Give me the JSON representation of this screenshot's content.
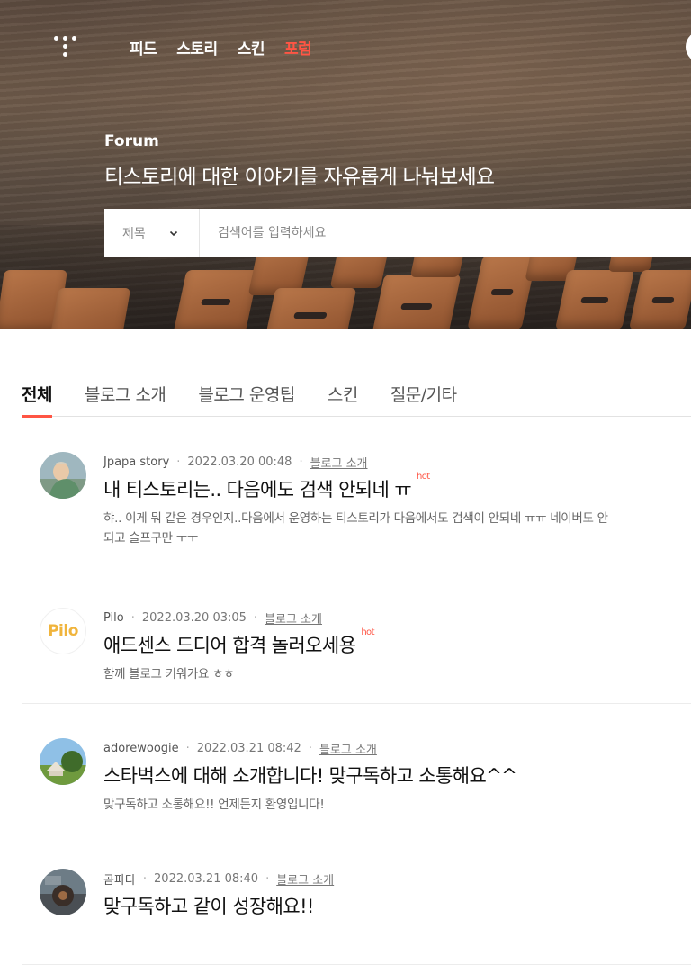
{
  "nav": {
    "items": [
      {
        "label": "피드",
        "active": false
      },
      {
        "label": "스토리",
        "active": false
      },
      {
        "label": "스킨",
        "active": false
      },
      {
        "label": "포럼",
        "active": true
      }
    ]
  },
  "hero": {
    "title": "Forum",
    "subtitle": "티스토리에 대한 이야기를 자유롭게 나눠보세요"
  },
  "search": {
    "scope": "제목",
    "placeholder": "검색어를 입력하세요"
  },
  "tabs": [
    {
      "label": "전체",
      "active": true
    },
    {
      "label": "블로그 소개",
      "active": false
    },
    {
      "label": "블로그 운영팁",
      "active": false
    },
    {
      "label": "스킨",
      "active": false
    },
    {
      "label": "질문/기타",
      "active": false
    }
  ],
  "posts": [
    {
      "author": "Jpapa story",
      "date": "2022.03.20 00:48",
      "category": "블로그 소개",
      "title": "내 티스토리는.. 다음에도 검색 안되네 ㅠ",
      "hot": "hot",
      "body": "햐.. 이게 뭐 같은 경우인지..다음에서 운영하는 티스토리가 다음에서도 검색이 안되네 ㅠㅠ 네이버도 안되고 슬프구만 ㅜㅜ"
    },
    {
      "author": "Pilo",
      "avatar_text": "Pilo",
      "date": "2022.03.20 03:05",
      "category": "블로그 소개",
      "title": "애드센스 드디어 합격 놀러오세용",
      "hot": "hot",
      "body": "함께 블로그 키워가요 ㅎㅎ"
    },
    {
      "author": "adorewoogie",
      "date": "2022.03.21 08:42",
      "category": "블로그 소개",
      "title": "스타벅스에 대해 소개합니다! 맞구독하고 소통해요^^",
      "body": "맞구독하고 소통해요!! 언제든지 환영입니다!"
    },
    {
      "author": "곰파다",
      "date": "2022.03.21 08:40",
      "category": "블로그 소개",
      "title": "맞구독하고 같이 성장해요!!",
      "body": ""
    }
  ],
  "colors": {
    "accent": "#ff5544",
    "text": "#111111",
    "muted": "#777777"
  }
}
